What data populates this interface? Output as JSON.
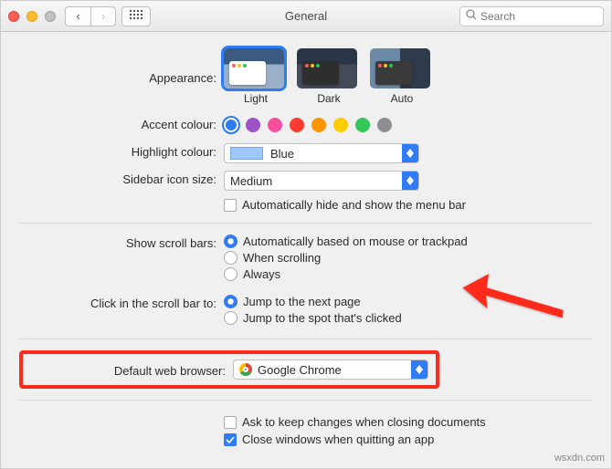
{
  "window": {
    "title": "General"
  },
  "search": {
    "placeholder": "Search"
  },
  "labels": {
    "appearance": "Appearance:",
    "accent": "Accent colour:",
    "highlight": "Highlight colour:",
    "sidebar_size": "Sidebar icon size:",
    "scroll_bars": "Show scroll bars:",
    "click_scroll": "Click in the scroll bar to:",
    "default_browser": "Default web browser:"
  },
  "appearance": {
    "options": [
      "Light",
      "Dark",
      "Auto"
    ],
    "selected": "Light"
  },
  "accent_colors": [
    "#2f7cf6",
    "#9d52c7",
    "#f74f9e",
    "#ff3b30",
    "#ff9500",
    "#ffcc00",
    "#34c759",
    "#8e8e93"
  ],
  "highlight_colour": {
    "value": "Blue"
  },
  "sidebar_icon_size": {
    "value": "Medium"
  },
  "menu_bar_autohide": {
    "label": "Automatically hide and show the menu bar",
    "checked": false
  },
  "scroll_bars": {
    "options": [
      "Automatically based on mouse or trackpad",
      "When scrolling",
      "Always"
    ],
    "selected_index": 0
  },
  "click_scroll": {
    "options": [
      "Jump to the next page",
      "Jump to the spot that's clicked"
    ],
    "selected_index": 0
  },
  "default_browser": {
    "value": "Google Chrome"
  },
  "closing": {
    "ask_keep_changes": {
      "label": "Ask to keep changes when closing documents",
      "checked": false
    },
    "close_windows": {
      "label": "Close windows when quitting an app",
      "checked": true
    }
  },
  "watermark": "wsxdn.com"
}
